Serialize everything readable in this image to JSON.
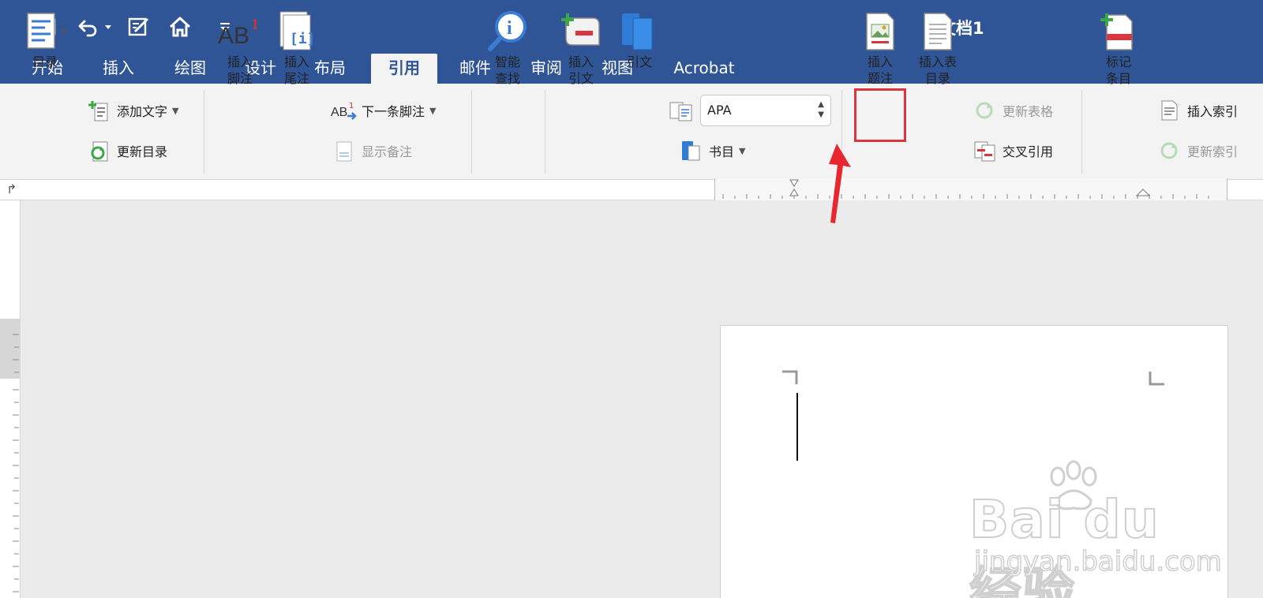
{
  "window": {
    "title": "文档1"
  },
  "tabs": [
    {
      "label": "开始"
    },
    {
      "label": "插入"
    },
    {
      "label": "绘图"
    },
    {
      "label": "设计"
    },
    {
      "label": "布局"
    },
    {
      "label": "引用"
    },
    {
      "label": "邮件"
    },
    {
      "label": "审阅"
    },
    {
      "label": "视图"
    },
    {
      "label": "Acrobat"
    }
  ],
  "active_tab": "引用",
  "ribbon": {
    "toc": {
      "label": "目录",
      "add_text": "添加文字",
      "update_toc": "更新目录"
    },
    "footnotes": {
      "insert_footnote": "插入\n脚注",
      "insert_endnote": "插入\n尾注",
      "next_footnote": "下一条脚注",
      "show_notes": "显示备注"
    },
    "research": {
      "smart_lookup": "智能\n查找"
    },
    "citations": {
      "insert_citation": "插入\n引文",
      "citations": "引文",
      "style_value": "APA",
      "bibliography": "书目"
    },
    "captions": {
      "insert_caption": "插入\n题注",
      "insert_table_of_figures": "插入表\n目录",
      "update_table": "更新表格",
      "cross_reference": "交叉引用"
    },
    "index": {
      "mark_entry": "标记\n条目",
      "insert_index": "插入索引",
      "update_index": "更新索引"
    }
  },
  "watermark": {
    "brand": "Bai du 经验",
    "url": "jingyan.baidu.com"
  },
  "colors": {
    "title_bar": "#2f5597",
    "ribbon_bg": "#f3f3f3",
    "highlight": "#d9363e",
    "canvas": "#ebebeb"
  }
}
